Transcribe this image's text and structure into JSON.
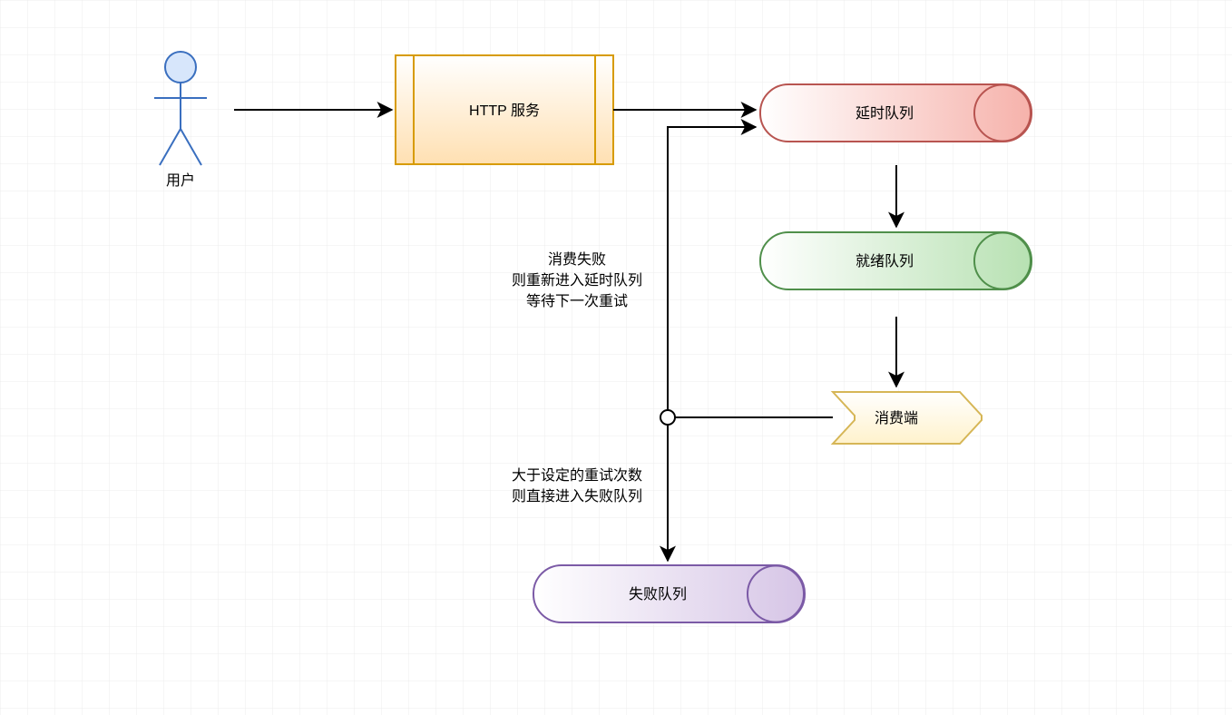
{
  "actor": {
    "label": "用户"
  },
  "http_service": {
    "label": "HTTP 服务"
  },
  "delay_queue": {
    "label": "延时队列"
  },
  "ready_queue": {
    "label": "就绪队列"
  },
  "fail_queue": {
    "label": "失败队列"
  },
  "consumer": {
    "label": "消费端"
  },
  "anno_retry": {
    "line1": "消费失败",
    "line2": "则重新进入延时队列",
    "line3": "等待下一次重试"
  },
  "anno_fail": {
    "line1": "大于设定的重试次数",
    "line2": "则直接进入失败队列"
  },
  "colors": {
    "grid": "#e8e8e8",
    "actor": "#1f4f9c",
    "http_stroke": "#d79b00",
    "http_fill_top": "#ffffff",
    "http_fill_bot": "#ffe0b2",
    "delay_stroke": "#b85450",
    "delay_fill_l": "#ffffff",
    "delay_fill_r": "#f6b2ab",
    "ready_stroke": "#4f8f4a",
    "ready_fill_l": "#ffffff",
    "ready_fill_r": "#b7e1b2",
    "fail_stroke": "#7b5aa6",
    "fail_fill_l": "#ffffff",
    "fail_fill_r": "#d6c5e6",
    "cons_stroke": "#d6b656",
    "cons_fill_top": "#ffffff",
    "cons_fill_bot": "#fff2cc",
    "arrow": "#000000"
  }
}
